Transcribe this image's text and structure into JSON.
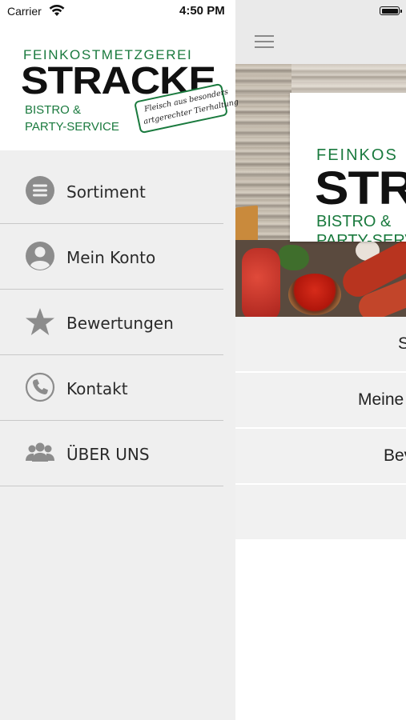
{
  "status_bar": {
    "carrier": "Carrier",
    "time": "4:50 PM",
    "wifi_icon": "wifi-icon",
    "battery_icon": "battery-icon"
  },
  "logo": {
    "line1": "FEINKOSTMETZGEREI",
    "line2": "STRACKE",
    "line3": "BISTRO &",
    "line4": "PARTY-SERVICE",
    "badge_line1": "Fleisch aus besonders",
    "badge_line2": "artgerechter Tierhaltung",
    "brand_green": "#1a7a3e"
  },
  "drawer": {
    "items": [
      {
        "label": "Sortiment",
        "icon": "list-icon"
      },
      {
        "label": "Mein Konto",
        "icon": "user-icon"
      },
      {
        "label": "Bewertungen",
        "icon": "star-icon"
      },
      {
        "label": "Kontakt",
        "icon": "phone-icon"
      },
      {
        "label": "ÜBER UNS",
        "icon": "group-icon"
      }
    ]
  },
  "main": {
    "menu_icon": "hamburger-icon",
    "sign_line1": "FEINKOS",
    "sign_line2": "STR",
    "sign_line3": "BISTRO &",
    "sign_line4": "PARTY-SERV",
    "items": [
      "S",
      "Meine",
      "Bev"
    ]
  }
}
